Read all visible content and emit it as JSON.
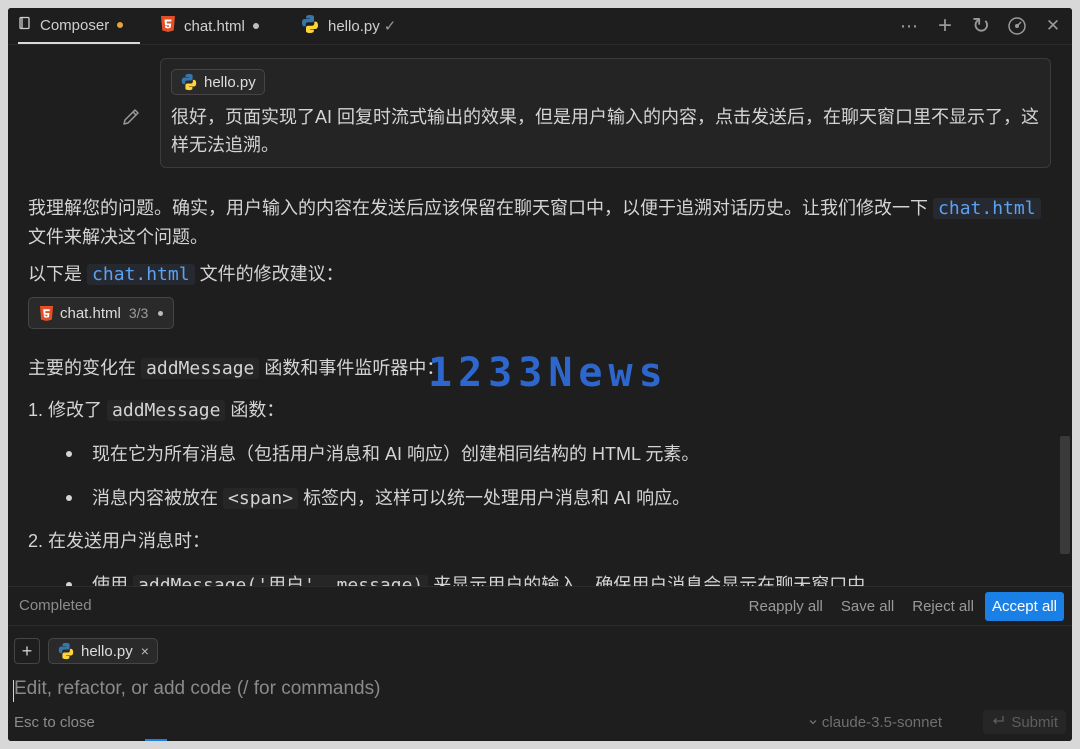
{
  "tabs": [
    {
      "label": "Composer",
      "icon": "composer-icon"
    },
    {
      "label": "chat.html",
      "icon": "html5-icon"
    },
    {
      "label": "hello.py",
      "icon": "python-icon",
      "status": "✓"
    }
  ],
  "toolbar": {
    "more": "⋯",
    "add": "+",
    "history": "↻",
    "settings": "⊙",
    "close": "✕"
  },
  "user_message": {
    "attachment": "hello.py",
    "text": "很好，页面实现了AI 回复时流式输出的效果，但是用户输入的内容，点击发送后，在聊天窗口里不显示了，这样无法追溯。"
  },
  "assistant": {
    "p1_a": "我理解您的问题。确实，用户输入的内容在发送后应该保留在聊天窗口中，以便于追溯对话历史。让我们修改一下",
    "p1_code": "chat.html",
    "p1_b": "文件来解决这个问题。",
    "p2_a": "以下是",
    "p2_code": "chat.html",
    "p2_b": "文件的修改建议：",
    "file_chip": {
      "name": "chat.html",
      "count": "3/3"
    },
    "p3_a": "主要的变化在",
    "p3_code": "addMessage",
    "p3_b": "函数和事件监听器中：",
    "p4_a": "1. 修改了",
    "p4_code": "addMessage",
    "p4_b": "函数：",
    "b1": "现在它为所有消息（包括用户消息和 AI 响应）创建相同结构的 HTML 元素。",
    "b2_a": "消息内容被放在",
    "b2_code": "<span>",
    "b2_b": "标签内，这样可以统一处理用户消息和 AI 响应。",
    "p5": "2. 在发送用户消息时：",
    "b3_a": "使用",
    "b3_code": "addMessage('用户', message)",
    "b3_b": "来显示用户的输入，确保用户消息会显示在聊天窗口中。"
  },
  "watermark": "1233News",
  "status": {
    "completed": "Completed",
    "reapply": "Reapply all",
    "save": "Save all",
    "reject": "Reject all",
    "accept": "Accept all"
  },
  "input": {
    "plus": "+",
    "context_chip": "hello.py",
    "chip_remove": "×",
    "placeholder": "Edit, refactor, or add code (/ for commands)",
    "esc_hint": "Esc to close",
    "model": "claude-3.5-sonnet",
    "submit": "Submit"
  },
  "colors": {
    "accent": "#1a80e6",
    "code_blue": "#5aa2f4",
    "background": "#1e1e1e"
  }
}
